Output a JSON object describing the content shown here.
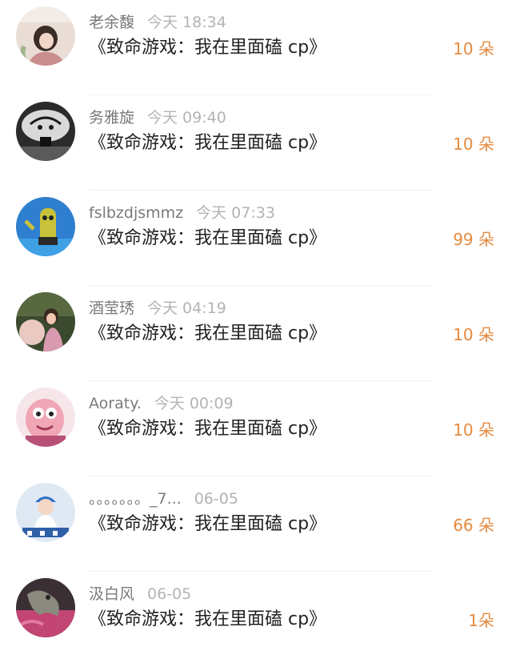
{
  "colors": {
    "amount": "#e58a3f",
    "title": "#222222",
    "username": "#7a7a7a",
    "time": "#b3b3b3",
    "divider": "#f1f1f1"
  },
  "rows": [
    {
      "avatar": "avatar-girl-pink-photo",
      "username": "老余馥",
      "time": "今天 18:34",
      "title": "《致命游戏：我在里面磕 cp》",
      "amount": "10 朵"
    },
    {
      "avatar": "avatar-monochrome-art",
      "username": "务雅旋",
      "time": "今天 09:40",
      "title": "《致命游戏：我在里面磕 cp》",
      "amount": "10 朵"
    },
    {
      "avatar": "avatar-cartoon-character-blue",
      "username": "fslbzdjsmmz",
      "time": "今天 07:33",
      "title": "《致命游戏：我在里面磕 cp》",
      "amount": "99 朵"
    },
    {
      "avatar": "avatar-child-with-balloon",
      "username": "酒莹琇",
      "time": "今天 04:19",
      "title": "《致命游戏：我在里面磕 cp》",
      "amount": "10 朵"
    },
    {
      "avatar": "avatar-pink-cartoon",
      "username": "Aoraty.",
      "time": "今天 00:09",
      "title": "《致命游戏：我在里面磕 cp》",
      "amount": "10 朵"
    },
    {
      "avatar": "avatar-boy-blue-cap",
      "username": "。。。。。。。_7...",
      "time": "06-05",
      "title": "《致命游戏：我在里面磕 cp》",
      "amount": "66 朵"
    },
    {
      "avatar": "avatar-dark-pink-dragon",
      "username": "汲白风",
      "time": "06-05",
      "title": "《致命游戏：我在里面磕 cp》",
      "amount": "1朵"
    }
  ]
}
